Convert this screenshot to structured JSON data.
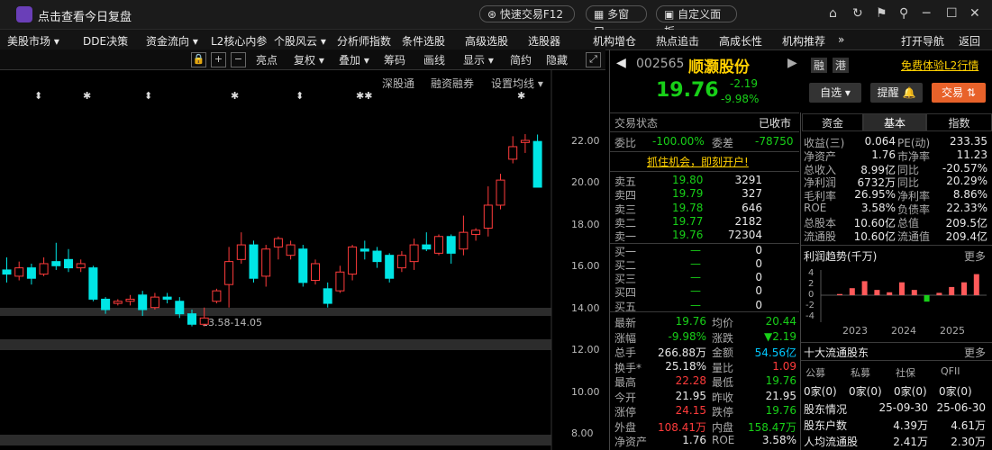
{
  "titlebar": {
    "title": "点击查看今日复盘",
    "quick_trade": "快速交易F12",
    "multi_window": "多窗口",
    "custom_panel": "自定义面板"
  },
  "menu": [
    "美股市场 ▾",
    "DDE决策",
    "资金流向 ▾",
    "L2核心内参",
    "个股风云 ▾",
    "分析师指数",
    "条件选股",
    "高级选股",
    "选股器",
    "机构增仓",
    "热点追击",
    "高成长性",
    "机构推荐",
    "»",
    "打开导航",
    "返回"
  ],
  "chart_toolbar": {
    "buttons": [
      "亮点",
      "复权 ▾",
      "叠加 ▾",
      "筹码",
      "画线",
      "显示 ▾",
      "简约",
      "隐藏"
    ],
    "sub_links": [
      "深股通",
      "融资融券",
      "设置均线 ▾"
    ],
    "y_labels": [
      "22.00",
      "20.00",
      "18.00",
      "16.00",
      "14.00",
      "12.00",
      "10.00",
      "8.00"
    ],
    "range_label": "13.58-14.05"
  },
  "chart_data": {
    "type": "candlestick",
    "y_range": [
      8.0,
      23.0
    ],
    "candles": [
      {
        "o": 15.8,
        "c": 15.6,
        "h": 16.4,
        "l": 15.2
      },
      {
        "o": 15.5,
        "c": 15.9,
        "h": 16.2,
        "l": 15.3
      },
      {
        "o": 15.9,
        "c": 15.4,
        "h": 16.1,
        "l": 15.1
      },
      {
        "o": 15.6,
        "c": 16.1,
        "h": 16.4,
        "l": 15.5
      },
      {
        "o": 16.2,
        "c": 16.0,
        "h": 17.1,
        "l": 15.8
      },
      {
        "o": 16.3,
        "c": 15.9,
        "h": 16.8,
        "l": 15.7
      },
      {
        "o": 15.9,
        "c": 16.1,
        "h": 16.3,
        "l": 15.7
      },
      {
        "o": 15.9,
        "c": 14.4,
        "h": 16.0,
        "l": 14.3
      },
      {
        "o": 14.4,
        "c": 13.9,
        "h": 14.5,
        "l": 13.7
      },
      {
        "o": 14.2,
        "c": 14.3,
        "h": 14.4,
        "l": 14.1
      },
      {
        "o": 14.3,
        "c": 14.4,
        "h": 14.6,
        "l": 14.1
      },
      {
        "o": 14.6,
        "c": 13.9,
        "h": 14.8,
        "l": 13.6
      },
      {
        "o": 14.0,
        "c": 14.5,
        "h": 14.7,
        "l": 13.9
      },
      {
        "o": 14.5,
        "c": 14.4,
        "h": 14.7,
        "l": 14.2
      },
      {
        "o": 14.3,
        "c": 13.7,
        "h": 14.5,
        "l": 13.5
      },
      {
        "o": 13.7,
        "c": 13.2,
        "h": 13.9,
        "l": 13.1
      },
      {
        "o": 13.2,
        "c": 13.5,
        "h": 14.0,
        "l": 13.1
      },
      {
        "o": 14.3,
        "c": 14.8,
        "h": 14.9,
        "l": 14.2
      },
      {
        "o": 15.1,
        "c": 16.2,
        "h": 16.9,
        "l": 14.0
      },
      {
        "o": 16.3,
        "c": 17.0,
        "h": 17.6,
        "l": 16.1
      },
      {
        "o": 17.0,
        "c": 15.4,
        "h": 17.2,
        "l": 15.2
      },
      {
        "o": 15.5,
        "c": 16.8,
        "h": 17.0,
        "l": 15.0
      },
      {
        "o": 16.9,
        "c": 17.3,
        "h": 17.4,
        "l": 16.3
      },
      {
        "o": 16.5,
        "c": 17.0,
        "h": 17.2,
        "l": 16.3
      },
      {
        "o": 16.8,
        "c": 15.2,
        "h": 17.0,
        "l": 15.0
      },
      {
        "o": 15.3,
        "c": 16.1,
        "h": 16.3,
        "l": 15.1
      },
      {
        "o": 14.9,
        "c": 14.2,
        "h": 15.2,
        "l": 14.0
      },
      {
        "o": 14.8,
        "c": 15.7,
        "h": 16.0,
        "l": 14.7
      },
      {
        "o": 15.6,
        "c": 16.9,
        "h": 17.0,
        "l": 15.3
      },
      {
        "o": 16.8,
        "c": 16.7,
        "h": 17.2,
        "l": 16.3
      },
      {
        "o": 16.7,
        "c": 16.2,
        "h": 16.9,
        "l": 15.9
      },
      {
        "o": 16.5,
        "c": 15.4,
        "h": 16.6,
        "l": 15.2
      },
      {
        "o": 15.9,
        "c": 16.5,
        "h": 16.7,
        "l": 15.7
      },
      {
        "o": 16.2,
        "c": 17.0,
        "h": 17.3,
        "l": 15.8
      },
      {
        "o": 17.0,
        "c": 16.8,
        "h": 17.6,
        "l": 16.7
      },
      {
        "o": 16.6,
        "c": 17.4,
        "h": 17.5,
        "l": 16.5
      },
      {
        "o": 17.4,
        "c": 16.6,
        "h": 17.5,
        "l": 16.1
      },
      {
        "o": 16.8,
        "c": 17.6,
        "h": 18.4,
        "l": 16.5
      },
      {
        "o": 17.5,
        "c": 17.7,
        "h": 17.8,
        "l": 17.2
      },
      {
        "o": 17.8,
        "c": 18.9,
        "h": 19.8,
        "l": 17.4
      },
      {
        "o": 18.9,
        "c": 20.1,
        "h": 20.4,
        "l": 18.7
      },
      {
        "o": 21.1,
        "c": 21.7,
        "h": 22.2,
        "l": 20.9
      },
      {
        "o": 21.9,
        "c": 22.0,
        "h": 22.3,
        "l": 21.4
      },
      {
        "o": 21.95,
        "c": 19.76,
        "h": 22.28,
        "l": 19.76
      }
    ]
  },
  "quote": {
    "code": "002565",
    "name": "顺灏股份",
    "tag1": "融",
    "tag2": "港",
    "promo": "免费体验L2行情",
    "price": "19.76",
    "change": "-2.19",
    "change_pct": "-9.98%",
    "btn_watch": "自选 ▾",
    "btn_alert": "提醒",
    "btn_trade": "交易",
    "status_label": "交易状态",
    "status_value": "已收市",
    "wb_label": "委比",
    "wb_value": "-100.00%",
    "wc_label": "委差",
    "wc_value": "-78750",
    "banner": "抓住机会，即刻开户!",
    "asks": [
      {
        "label": "卖五",
        "price": "19.80",
        "vol": "3291"
      },
      {
        "label": "卖四",
        "price": "19.79",
        "vol": "327"
      },
      {
        "label": "卖三",
        "price": "19.78",
        "vol": "646"
      },
      {
        "label": "卖二",
        "price": "19.77",
        "vol": "2182"
      },
      {
        "label": "卖一",
        "price": "19.76",
        "vol": "72304"
      }
    ],
    "bids": [
      {
        "label": "买一",
        "price": "—",
        "vol": "0"
      },
      {
        "label": "买二",
        "price": "—",
        "vol": "0"
      },
      {
        "label": "买三",
        "price": "—",
        "vol": "0"
      },
      {
        "label": "买四",
        "price": "—",
        "vol": "0"
      },
      {
        "label": "买五",
        "price": "—",
        "vol": "0"
      }
    ],
    "stats": [
      {
        "l1": "最新",
        "v1": "19.76",
        "c1": "green",
        "l2": "均价",
        "v2": "20.44",
        "c2": "green"
      },
      {
        "l1": "涨幅",
        "v1": "-9.98%",
        "c1": "green",
        "l2": "涨跌",
        "v2": "▼2.19",
        "c2": "green"
      },
      {
        "l1": "总手",
        "v1": "266.88万",
        "c1": "white",
        "l2": "金额",
        "v2": "54.56亿",
        "c2": "cyan"
      },
      {
        "l1": "换手*",
        "v1": "25.18%",
        "c1": "white",
        "l2": "量比",
        "v2": "1.09",
        "c2": "red"
      },
      {
        "l1": "最高",
        "v1": "22.28",
        "c1": "red",
        "l2": "最低",
        "v2": "19.76",
        "c2": "green"
      },
      {
        "l1": "今开",
        "v1": "21.95",
        "c1": "white",
        "l2": "昨收",
        "v2": "21.95",
        "c2": "white"
      },
      {
        "l1": "涨停",
        "v1": "24.15",
        "c1": "red",
        "l2": "跌停",
        "v2": "19.76",
        "c2": "green"
      },
      {
        "l1": "外盘",
        "v1": "108.41万",
        "c1": "red",
        "l2": "内盘",
        "v2": "158.47万",
        "c2": "green"
      },
      {
        "l1": "净资产",
        "v1": "1.76",
        "c1": "white",
        "l2": "ROE",
        "v2": "3.58%",
        "c2": "white"
      }
    ]
  },
  "fundamentals": {
    "tabs": [
      "资金",
      "基本",
      "指数"
    ],
    "rows": [
      {
        "l1": "收益(三)",
        "v1": "0.064",
        "l2": "PE(动)",
        "v2": "233.35"
      },
      {
        "l1": "净资产",
        "v1": "1.76",
        "l2": "市净率",
        "v2": "11.23"
      },
      {
        "l1": "总收入",
        "v1": "8.99亿",
        "l2": "同比",
        "v2": "-20.57%"
      },
      {
        "l1": "净利润",
        "v1": "6732万",
        "l2": "同比",
        "v2": "20.29%"
      },
      {
        "l1": "毛利率",
        "v1": "26.95%",
        "l2": "净利率",
        "v2": "8.86%"
      },
      {
        "l1": "ROE",
        "v1": "3.58%",
        "l2": "负债率",
        "v2": "22.33%"
      },
      {
        "l1": "总股本",
        "v1": "10.60亿",
        "l2": "总值",
        "v2": "209.5亿"
      },
      {
        "l1": "流通股",
        "v1": "10.60亿",
        "l2": "流通值",
        "v2": "209.4亿"
      }
    ],
    "profit_title": "利润趋势(千万)",
    "more": "更多",
    "profit_y": [
      "4",
      "2",
      "0",
      "-2",
      "-4"
    ],
    "profit_years": [
      "2023",
      "2024",
      "2025"
    ],
    "profit_bars": [
      0.2,
      1.2,
      2.4,
      0.9,
      0.5,
      2.2,
      0.9,
      -1.1,
      0.4,
      1.4,
      2.2,
      3.6
    ],
    "holders_title": "十大流通股东",
    "holder_types": [
      "公募",
      "私募",
      "社保",
      "QFII"
    ],
    "holder_counts": [
      "0家(0)",
      "0家(0)",
      "0家(0)",
      "0家(0)"
    ],
    "holder_rows": [
      {
        "l": "股东情况",
        "v1": "25-09-30",
        "v2": "25-06-30"
      },
      {
        "l": "股东户数",
        "v1": "4.39万",
        "v2": "4.61万"
      },
      {
        "l": "人均流通股",
        "v1": "2.41万",
        "v2": "2.30万"
      }
    ]
  },
  "colors": {
    "up": "#ff3b3b",
    "down": "#00e5e5",
    "accent": "#ffd000",
    "price_down": "#18d018"
  }
}
